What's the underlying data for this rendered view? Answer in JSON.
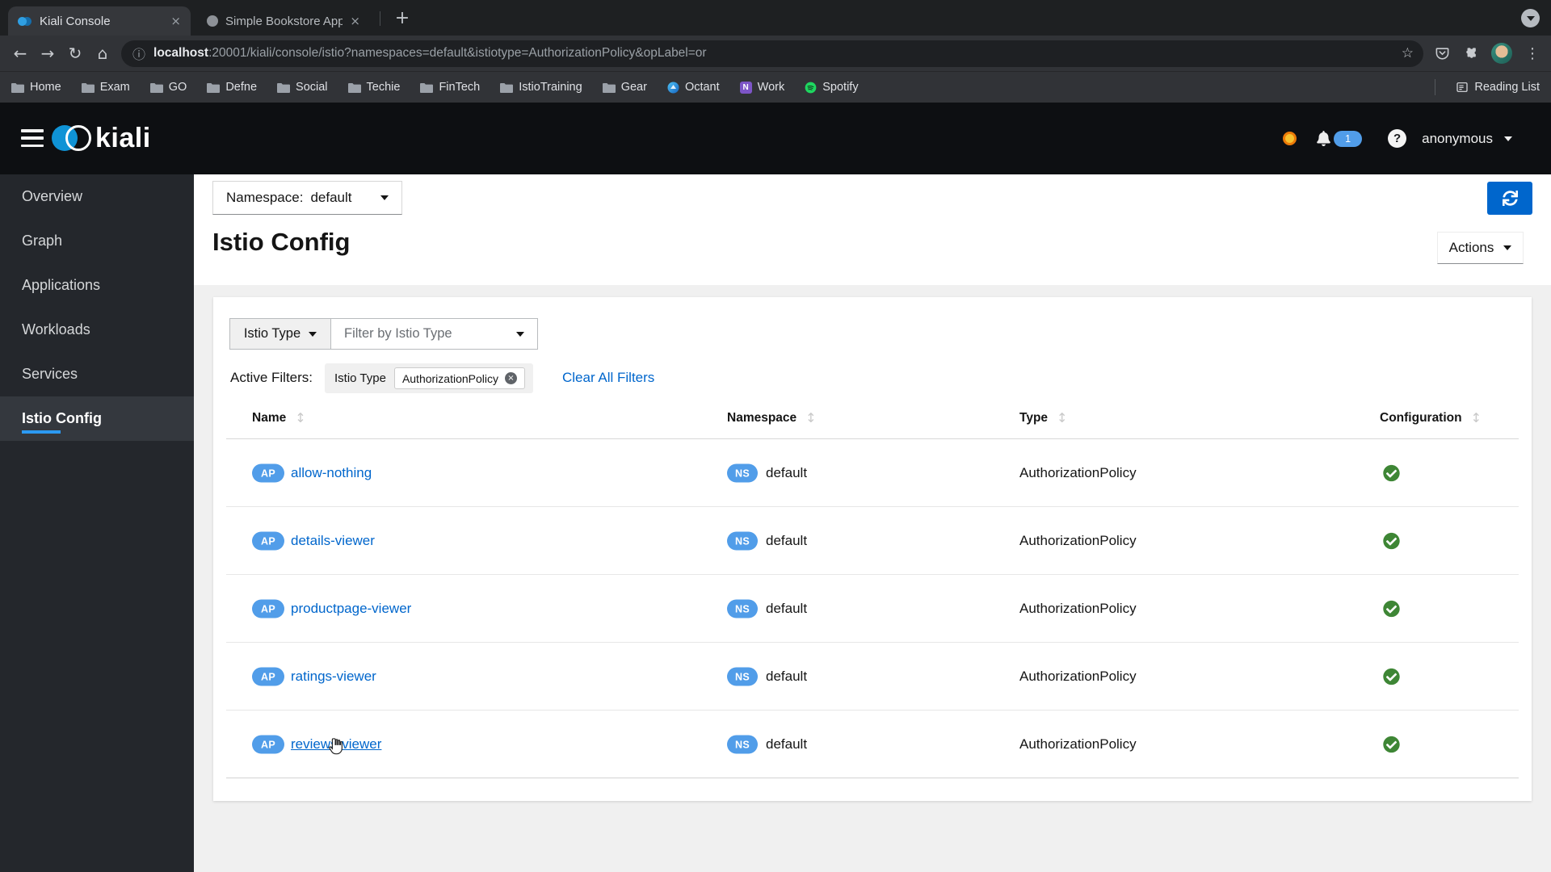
{
  "browser": {
    "tabs": [
      {
        "title": "Kiali Console"
      },
      {
        "title": "Simple Bookstore App"
      }
    ],
    "new_tab_label": "+",
    "url_host": "localhost",
    "url_rest": ":20001/kiali/console/istio?namespaces=default&istiotype=AuthorizationPolicy&opLabel=or",
    "bookmarks": [
      {
        "label": "Home",
        "icon": "folder"
      },
      {
        "label": "Exam",
        "icon": "folder"
      },
      {
        "label": "GO",
        "icon": "folder"
      },
      {
        "label": "Defne",
        "icon": "folder"
      },
      {
        "label": "Social",
        "icon": "folder"
      },
      {
        "label": "Techie",
        "icon": "folder"
      },
      {
        "label": "FinTech",
        "icon": "folder"
      },
      {
        "label": "IstioTraining",
        "icon": "folder"
      },
      {
        "label": "Gear",
        "icon": "folder"
      },
      {
        "label": "Octant",
        "icon": "octant"
      },
      {
        "label": "Work",
        "icon": "notion"
      },
      {
        "label": "Spotify",
        "icon": "spotify"
      }
    ],
    "reading_list_label": "Reading List"
  },
  "masthead": {
    "brand": "kiali",
    "notification_count": "1",
    "user": "anonymous"
  },
  "sidebar": {
    "items": [
      {
        "label": "Overview"
      },
      {
        "label": "Graph"
      },
      {
        "label": "Applications"
      },
      {
        "label": "Workloads"
      },
      {
        "label": "Services"
      },
      {
        "label": "Istio Config"
      }
    ]
  },
  "page": {
    "namespace_label": "Namespace:",
    "namespace_value": "default",
    "title": "Istio Config",
    "actions_label": "Actions"
  },
  "filters": {
    "type_toggle": "Istio Type",
    "placeholder": "Filter by Istio Type",
    "active_label": "Active Filters:",
    "chip_category": "Istio Type",
    "chip_value": "AuthorizationPolicy",
    "clear_all": "Clear All Filters"
  },
  "table": {
    "columns": [
      "Name",
      "Namespace",
      "Type",
      "Configuration"
    ],
    "rows": [
      {
        "badge": "AP",
        "name": "allow-nothing",
        "ns_badge": "NS",
        "namespace": "default",
        "type": "AuthorizationPolicy",
        "status": "valid"
      },
      {
        "badge": "AP",
        "name": "details-viewer",
        "ns_badge": "NS",
        "namespace": "default",
        "type": "AuthorizationPolicy",
        "status": "valid"
      },
      {
        "badge": "AP",
        "name": "productpage-viewer",
        "ns_badge": "NS",
        "namespace": "default",
        "type": "AuthorizationPolicy",
        "status": "valid"
      },
      {
        "badge": "AP",
        "name": "ratings-viewer",
        "ns_badge": "NS",
        "namespace": "default",
        "type": "AuthorizationPolicy",
        "status": "valid"
      },
      {
        "badge": "AP",
        "name": "reviews-viewer",
        "ns_badge": "NS",
        "namespace": "default",
        "type": "AuthorizationPolicy",
        "status": "valid"
      }
    ]
  },
  "colors": {
    "primary_blue": "#0066cc",
    "link_blue": "#0066cc",
    "badge_blue": "#519de9",
    "valid_green": "#3e8635",
    "nav_active_blue": "#2b9af3",
    "status_orange": "#f0ab00"
  }
}
